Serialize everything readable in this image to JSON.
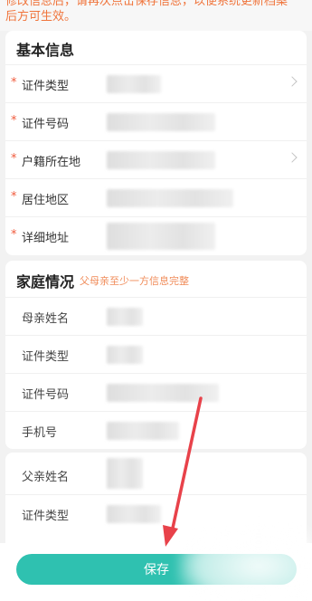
{
  "notice": {
    "line1": "修改信息后，请再次点击保存信息，以便系统更新档案",
    "line2": "后方可生效。"
  },
  "basic_info": {
    "title": "基本信息",
    "rows": [
      {
        "label": "证件类型",
        "required": "*"
      },
      {
        "label": "证件号码",
        "required": "*"
      },
      {
        "label": "户籍所在地",
        "required": "*"
      },
      {
        "label": "居住地区",
        "required": "*"
      },
      {
        "label": "详细地址",
        "required": "*"
      }
    ]
  },
  "family": {
    "title": "家庭情况",
    "hint": "父母亲至少一方信息完整",
    "rows": [
      {
        "label": "母亲姓名"
      },
      {
        "label": "证件类型"
      },
      {
        "label": "证件号码"
      },
      {
        "label": "手机号"
      }
    ],
    "father_rows": [
      {
        "label": "父亲姓名"
      },
      {
        "label": "证件类型"
      }
    ]
  },
  "save_label": "保存",
  "colors": {
    "accent": "#2fc1b0",
    "required": "#f05a3c",
    "notice": "#f0743b",
    "arrow": "#e8424a"
  },
  "icons": [
    "chevron-right-icon",
    "red-arrow-annotation"
  ]
}
